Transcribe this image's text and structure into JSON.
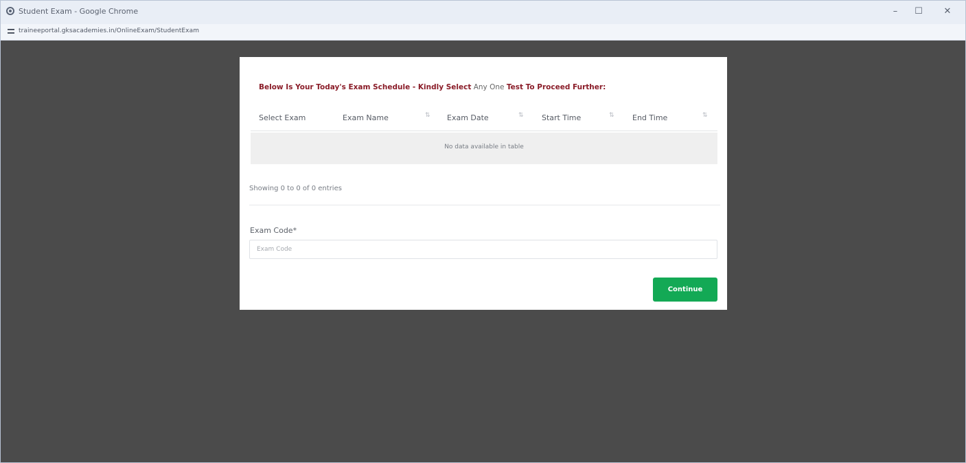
{
  "window": {
    "title": "Student Exam - Google Chrome",
    "minimize_symbol": "–",
    "maximize_symbol": "☐",
    "close_symbol": "✕"
  },
  "address_bar": {
    "url": "traineeportal.gksacademies.in/OnlineExam/StudentExam"
  },
  "modal": {
    "heading": {
      "part1": "Below Is Your Today's Exam Schedule - Kindly Select",
      "part2": " Any One ",
      "part3": "Test To Proceed Further:"
    },
    "table": {
      "columns": [
        "Select Exam",
        "Exam Name",
        "Exam Date",
        "Start Time",
        "End Time"
      ],
      "sort_symbol": "⇅",
      "empty_message": "No data available in table"
    },
    "info": "Showing 0 to 0 of 0 entries",
    "exam_code": {
      "label": "Exam Code*",
      "placeholder": "Exam Code",
      "value": ""
    },
    "continue_label": "Continue"
  },
  "colors": {
    "heading_red": "#8a1c28",
    "button_green": "#13a955",
    "backdrop": "#4b4b4b"
  }
}
